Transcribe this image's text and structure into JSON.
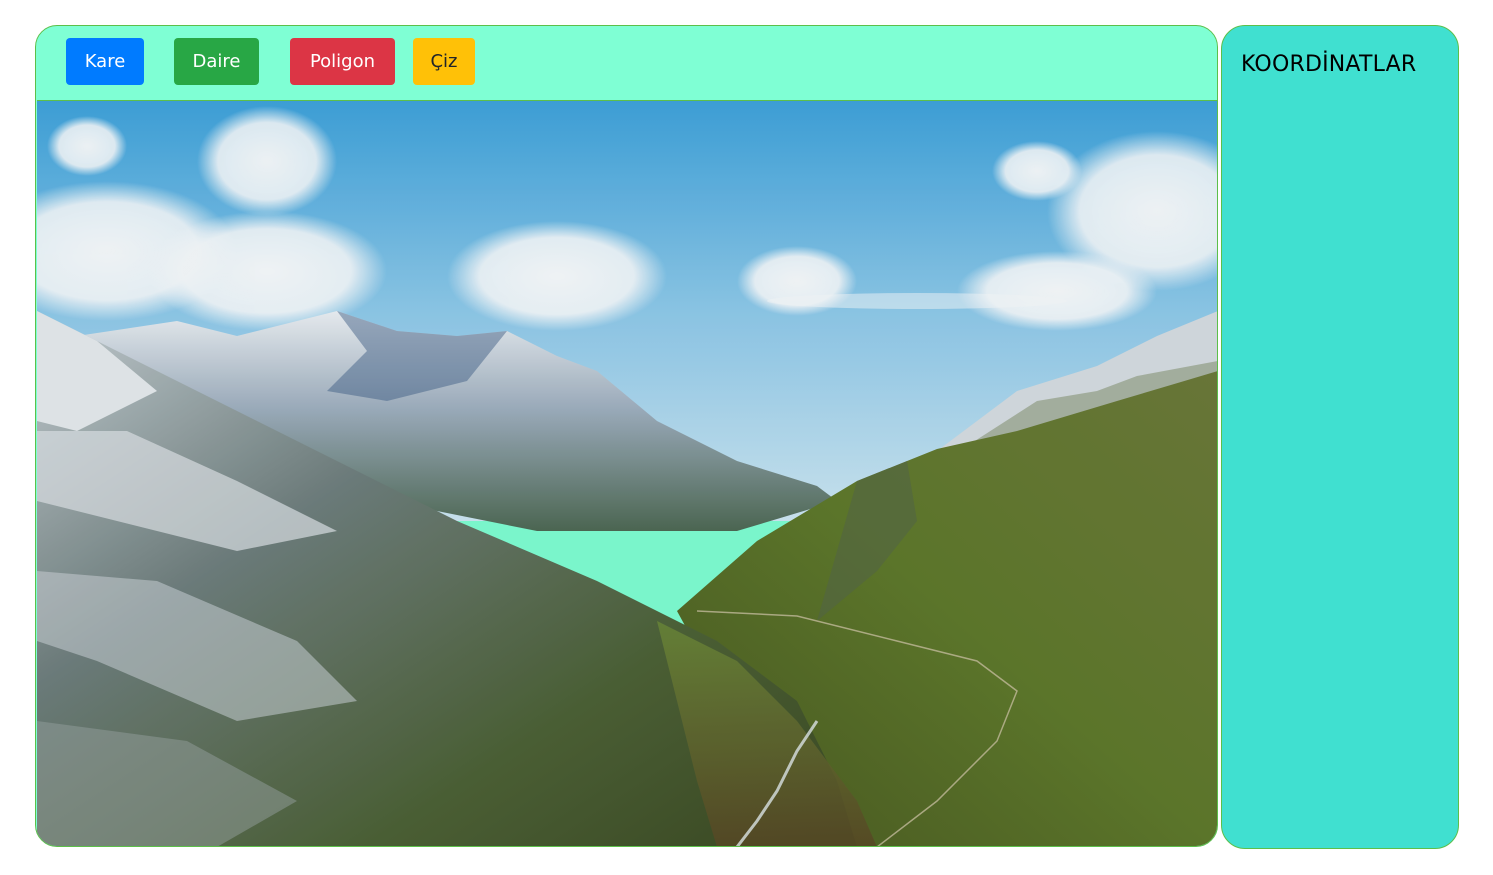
{
  "toolbar": {
    "buttons": [
      {
        "label": "Kare",
        "color": "#007bff"
      },
      {
        "label": "Daire",
        "color": "#28a745"
      },
      {
        "label": "Poligon",
        "color": "#dc3545"
      },
      {
        "label": "Çiz",
        "color": "#ffc107"
      }
    ]
  },
  "canvas": {
    "image": "mountain-valley-photo"
  },
  "sidebar": {
    "title": "KOORDİNATLAR"
  },
  "colors": {
    "main_panel_bg": "#7fffd4",
    "sidebar_bg": "#40e0d0",
    "border": "#5cbf4a"
  }
}
